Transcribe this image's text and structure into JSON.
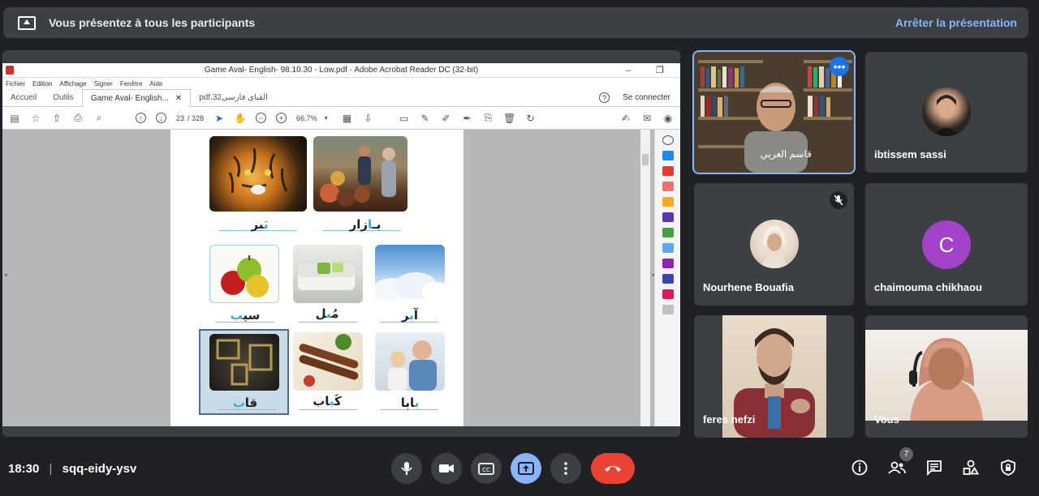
{
  "banner": {
    "message": "Vous présentez à tous les participants",
    "stop_label": "Arrêter la présentation"
  },
  "acrobat": {
    "window_title": "Game Aval- English-  98.10.30 - Low.pdf - Adobe Acrobat Reader DC (32-bit)",
    "menu": [
      "Fichier",
      "Edition",
      "Affichage",
      "Signer",
      "Fenêtre",
      "Aide"
    ],
    "tabs": [
      "Accueil",
      "Outils",
      "Game Aval- English...",
      "pdf.32القبای فارسی"
    ],
    "help": "?",
    "connect": "Se connecter",
    "page_current": "23",
    "page_total": "/ 328",
    "zoom": "66,7%",
    "words": [
      {
        "pre": "",
        "acc": "بَ",
        "post": "ببر",
        "text": "بَبر"
      },
      {
        "pre": "",
        "acc": "با",
        "post": "زار",
        "text": "بازار"
      },
      {
        "text": "سیب"
      },
      {
        "text": "مُبل"
      },
      {
        "text": "آبر"
      },
      {
        "text": "قاب"
      },
      {
        "text": "کَباب"
      },
      {
        "text": "بابا"
      }
    ]
  },
  "participants": [
    {
      "name": "قاسم الغربي",
      "initial": ""
    },
    {
      "name": "ibtissem sassi",
      "initial": ""
    },
    {
      "name": "Nourhene Bouafia",
      "initial": ""
    },
    {
      "name": "chaimouma chikhaou",
      "initial": "C"
    },
    {
      "name": "feres nefzi",
      "initial": ""
    },
    {
      "name": "Vous",
      "initial": ""
    }
  ],
  "bottom": {
    "time": "18:30",
    "separator": "|",
    "meeting_code": "sqq-eidy-ysv",
    "people_count": "7"
  },
  "colors": {
    "accent_blue": "#8ab4f8",
    "end_call_red": "#ea4335",
    "avatar_purple": "#a142c9"
  }
}
